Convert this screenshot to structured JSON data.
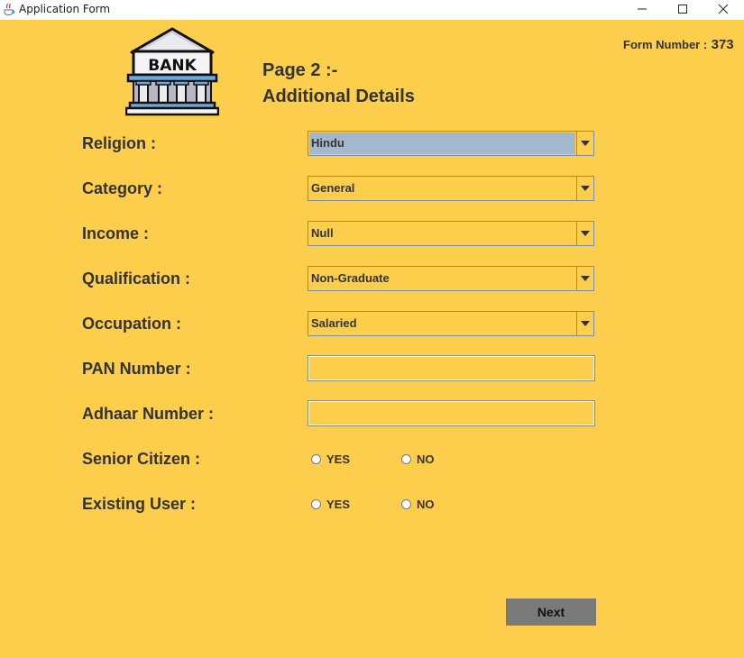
{
  "window": {
    "title": "Application Form",
    "icon": "java-cup-icon",
    "controls": [
      "minimize-icon",
      "maximize-icon",
      "close-icon"
    ]
  },
  "header": {
    "logo_text": "BANK",
    "page_title_line1": "Page 2 :-",
    "page_title_line2": "Additional Details",
    "form_number_label": "Form Number :",
    "form_number_value": "373"
  },
  "fields": {
    "religion": {
      "label": "Religion :",
      "value": "Hindu"
    },
    "category": {
      "label": "Category :",
      "value": "General"
    },
    "income": {
      "label": "Income :",
      "value": "Null"
    },
    "qualification": {
      "label": "Qualification :",
      "value": "Non-Graduate"
    },
    "occupation": {
      "label": "Occupation :",
      "value": "Salaried"
    },
    "pan": {
      "label": "PAN Number :",
      "value": ""
    },
    "adhaar": {
      "label": "Adhaar Number :",
      "value": ""
    },
    "senior_citizen": {
      "label": "Senior Citizen :",
      "yes": "YES",
      "no": "NO",
      "selected": null
    },
    "existing_user": {
      "label": "Existing User :",
      "yes": "YES",
      "no": "NO",
      "selected": null
    }
  },
  "actions": {
    "next_label": "Next"
  },
  "colors": {
    "background": "#fcce4b",
    "text": "#333333",
    "combo_highlight": "#a3b8cc",
    "next_button": "#7a7a7a"
  }
}
